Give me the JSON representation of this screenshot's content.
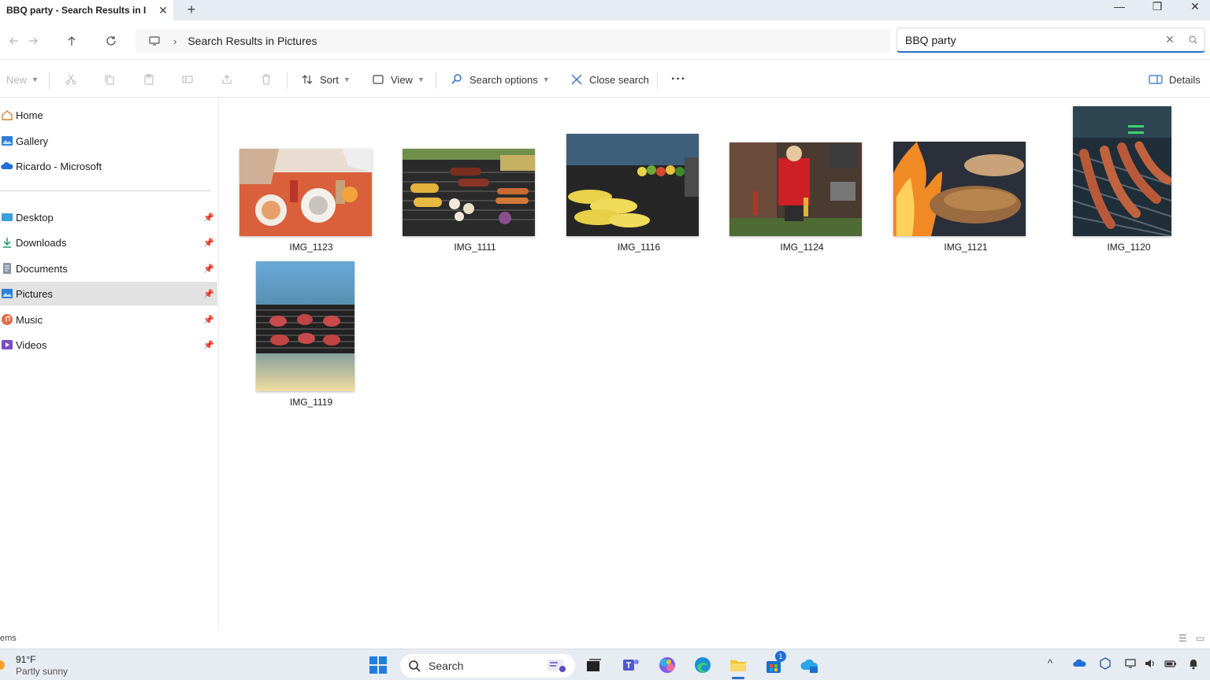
{
  "window": {
    "tab_title": "BBQ party - Search Results in I",
    "tab_close": "✕",
    "new_tab": "+",
    "controls": {
      "minimize": "—",
      "maximize": "❐",
      "close": "✕"
    }
  },
  "address": {
    "separator": "›",
    "breadcrumb": "Search Results in Pictures"
  },
  "search": {
    "value": "BBQ party",
    "clear": "✕"
  },
  "toolbar": {
    "new_label": "New",
    "sort_label": "Sort",
    "view_label": "View",
    "search_options_label": "Search options",
    "close_search_label": "Close search",
    "more_label": "···",
    "details_label": "Details"
  },
  "sidebar": {
    "top_items": [
      {
        "label": "Home",
        "icon": "home-icon"
      },
      {
        "label": "Gallery",
        "icon": "gallery-icon"
      },
      {
        "label": "Ricardo - Microsoft",
        "icon": "onedrive-icon"
      }
    ],
    "pinned_items": [
      {
        "label": "Desktop",
        "icon": "desktop-icon",
        "pin": "📌"
      },
      {
        "label": "Downloads",
        "icon": "download-icon",
        "pin": "📌"
      },
      {
        "label": "Documents",
        "icon": "documents-icon",
        "pin": "📌"
      },
      {
        "label": "Pictures",
        "icon": "pictures-icon",
        "pin": "📌",
        "selected": true
      },
      {
        "label": "Music",
        "icon": "music-icon",
        "pin": "📌"
      },
      {
        "label": "Videos",
        "icon": "videos-icon",
        "pin": "📌"
      }
    ]
  },
  "files": [
    {
      "name": "IMG_1123"
    },
    {
      "name": "IMG_1111"
    },
    {
      "name": "IMG_1116"
    },
    {
      "name": "IMG_1124"
    },
    {
      "name": "IMG_1121"
    },
    {
      "name": "IMG_1120"
    },
    {
      "name": "IMG_1119"
    }
  ],
  "status": {
    "item_count_text": "ems"
  },
  "taskbar": {
    "temperature": "91°F",
    "condition": "Partly sunny",
    "search_label": "Search",
    "notification_badge": "1"
  },
  "colors": {
    "accent": "#2b6fc9",
    "selected_bg": "#e2e2e2",
    "titlebar_bg": "#e6ecf4",
    "taskbar_bg": "#e7ebf2"
  }
}
